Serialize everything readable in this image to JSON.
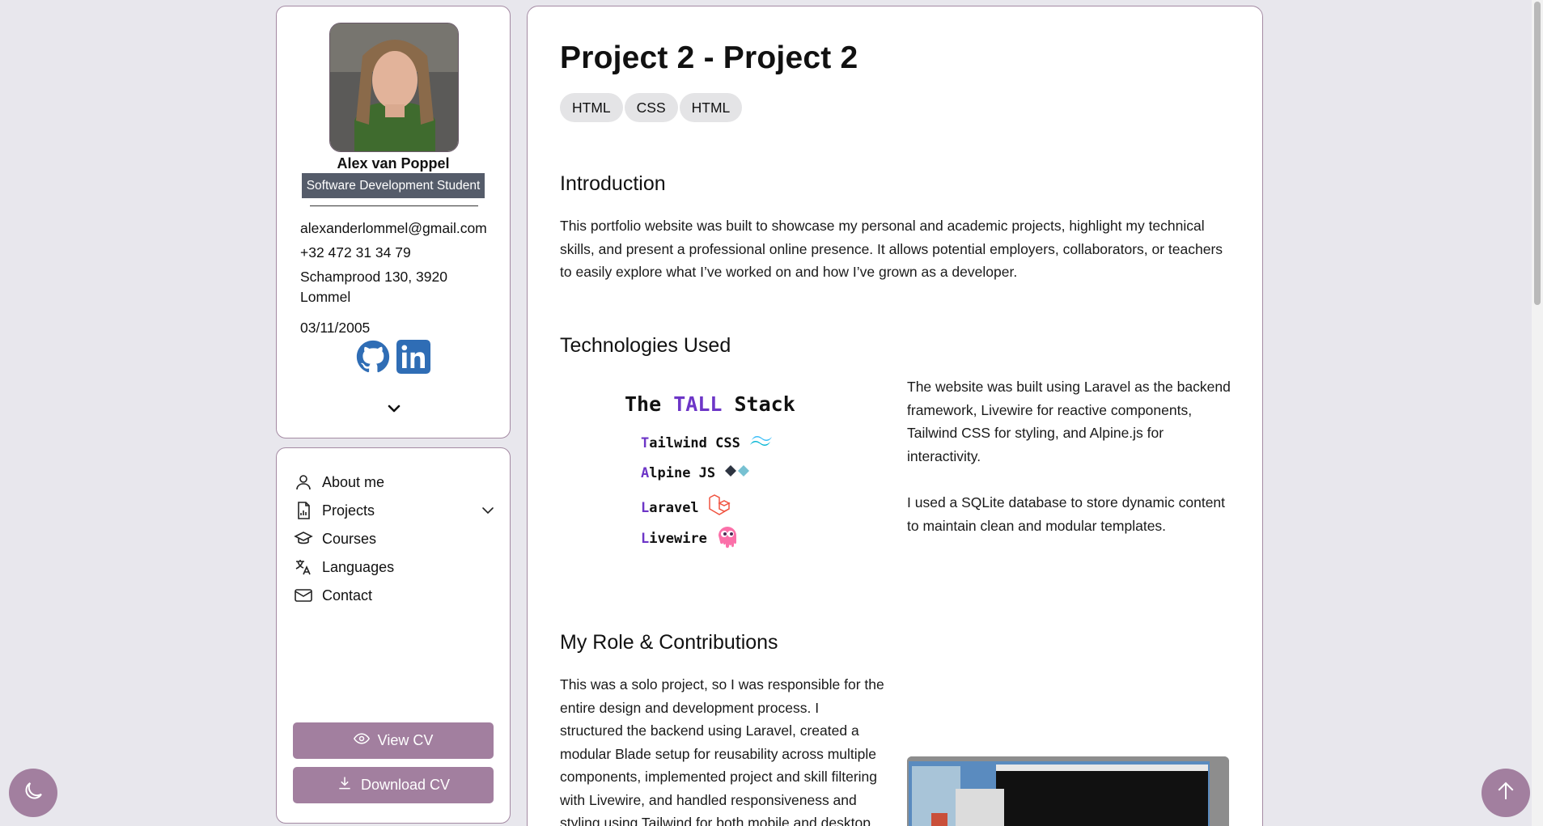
{
  "profile": {
    "name": "Alex van Poppel",
    "role": "Software Development Student",
    "email": "alexanderlommel@gmail.com",
    "phone": "+32 472 31 34 79",
    "address_line1": "Schamprood 130, 3920",
    "address_line2": "Lommel",
    "birthdate": "03/11/2005",
    "socials": [
      "github-icon",
      "linkedin-icon"
    ]
  },
  "nav": {
    "items": [
      {
        "label": "About me",
        "icon": "user-icon"
      },
      {
        "label": "Projects",
        "icon": "report-icon"
      },
      {
        "label": "Courses",
        "icon": "graduation-cap-icon"
      },
      {
        "label": "Languages",
        "icon": "translate-icon"
      },
      {
        "label": "Contact",
        "icon": "mail-icon"
      }
    ],
    "view_cv": "View CV",
    "download_cv": "Download CV"
  },
  "main": {
    "title": "Project 2 - Project 2",
    "tags": [
      "HTML",
      "CSS",
      "HTML"
    ],
    "intro_heading": "Introduction",
    "intro_lines": [
      "This portfolio website was built to showcase my personal and academic projects, highlight my technical",
      "skills, and present a professional online presence. It allows potential employers, collaborators, or teachers",
      "to easily explore what I’ve worked on and how I’ve grown as a developer."
    ],
    "tech_heading": "Technologies Used",
    "tech_lines": [
      "The website was built using Laravel as the backend",
      "framework, Livewire for reactive components,",
      "Tailwind CSS for styling, and Alpine.js for",
      "interactivity."
    ],
    "tech_lines2": [
      "I used a SQLite database to store dynamic content",
      "to maintain clean and modular templates."
    ],
    "tall": {
      "title_a": "The ",
      "title_b": "TALL",
      "title_c": " Stack",
      "rows": [
        {
          "first": "T",
          "rest": "ailwind CSS"
        },
        {
          "first": "A",
          "rest": "lpine JS"
        },
        {
          "first": "L",
          "rest": "aravel"
        },
        {
          "first": "L",
          "rest": "ivewire"
        }
      ]
    },
    "role_heading": "My Role & Contributions",
    "role_lines": [
      "This was a solo project, so I was responsible for the",
      "entire design and development process. I",
      "structured the backend using Laravel, created a",
      "modular Blade setup for reusability across multiple",
      "components, implemented project and skill filtering",
      "with Livewire, and handled responsiveness and",
      "styling using Tailwind for both mobile and desktop"
    ]
  },
  "colors": {
    "accent": "#a27f9f",
    "border": "#a48aa3",
    "badge": "#555c6a",
    "social_blue": "#2f6db5",
    "tall_purple": "#6d36c7"
  }
}
